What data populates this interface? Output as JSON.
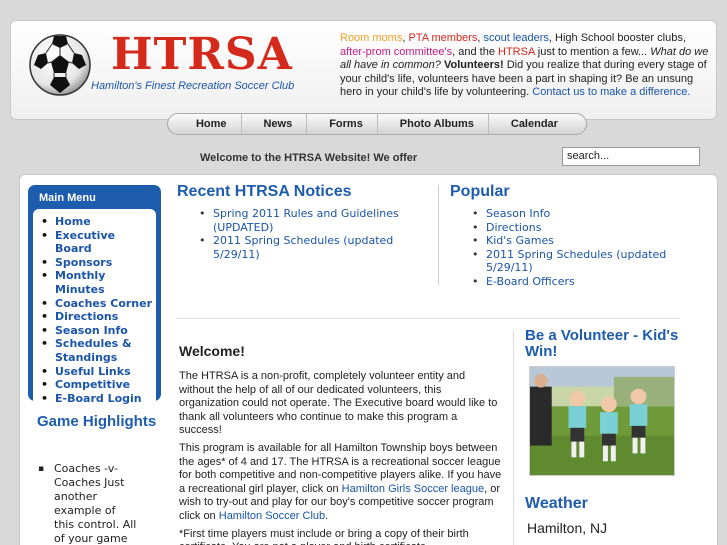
{
  "header": {
    "logo_title": "HTRSA",
    "logo_subtitle": "Hamilton's Finest Recreation Soccer Club",
    "intro": {
      "p1": "Room moms",
      "sep1": ", ",
      "p2": "PTA members",
      "sep2": ", ",
      "p3": "scout leaders",
      "sep3": ", High School booster clubs, ",
      "p4": "after-prom committee's",
      "sep4": ", and the ",
      "p5": "HTRSA",
      "sep5": " just to mention a few... ",
      "question": "What do we all have in common?",
      "sep6": " ",
      "volunteers": "Volunteers!",
      "rest": " Did you realize that during every stage of your child's life, volunteers have been a part in shaping it? Be an unsung hero in your child's life by volunteering. ",
      "contact_link": "Contact us to make a difference."
    }
  },
  "nav": {
    "items": [
      {
        "label": "Home"
      },
      {
        "label": "News"
      },
      {
        "label": "Forms"
      },
      {
        "label": "Photo Albums"
      },
      {
        "label": "Calendar"
      }
    ]
  },
  "ticker": "Welcome to the HTRSA Website! We offer",
  "search": {
    "value": "search..."
  },
  "menu": {
    "title": "Main Menu",
    "items": [
      {
        "label": "Home"
      },
      {
        "label": "Executive Board"
      },
      {
        "label": "Sponsors"
      },
      {
        "label": "Monthly Minutes"
      },
      {
        "label": "Coaches Corner"
      },
      {
        "label": "Directions"
      },
      {
        "label": "Season Info"
      },
      {
        "label": "Schedules & Standings"
      },
      {
        "label": "Useful Links"
      },
      {
        "label": "Competitive"
      },
      {
        "label": "E-Board Login"
      }
    ]
  },
  "game_highlights": {
    "title": "Game Highlights",
    "item": "Coaches -v- Coaches Just another example of this control. All of your game"
  },
  "notices": {
    "title": "Recent HTRSA Notices",
    "items": [
      {
        "label": "Spring 2011 Rules and Guidelines (UPDATED)"
      },
      {
        "label": "2011 Spring Schedules (updated 5/29/11)"
      }
    ]
  },
  "popular": {
    "title": "Popular",
    "items": [
      {
        "label": "Season Info"
      },
      {
        "label": "Directions"
      },
      {
        "label": "Kid's Games"
      },
      {
        "label": "2011 Spring Schedules (updated 5/29/11)"
      },
      {
        "label": "E-Board Officers"
      }
    ]
  },
  "welcome": {
    "title": "Welcome!",
    "p1": "The HTRSA is a non-profit, completely volunteer entity and without the help of all of our dedicated volunteers, this organization could not operate. The Executive board would like to thank all volunteers who continue to make this program a success!",
    "p2a": "This program is available for all Hamilton Township boys between the ages* of 4 and 17. The HTRSA is a recreational soccer league for both competitive and non-competitive players alike. If you have a recreational girl player, click on ",
    "p2_link1": "Hamilton Girls Soccer league",
    "p2b": ", or wish to try-out and play for our boy's competitive soccer program click on ",
    "p2_link2": "Hamilton Soccer Club",
    "p2c": ".",
    "p3": "*First time players must include or bring a copy of their birth certificate. You are not a player and birth certificate."
  },
  "volunteer": {
    "title": "Be a Volunteer - Kid's Win!"
  },
  "weather": {
    "title": "Weather",
    "city": "Hamilton, NJ"
  },
  "colors": {
    "brand_red": "#d42a1c",
    "brand_blue": "#1e5cae",
    "link_blue": "#1a55a8"
  }
}
